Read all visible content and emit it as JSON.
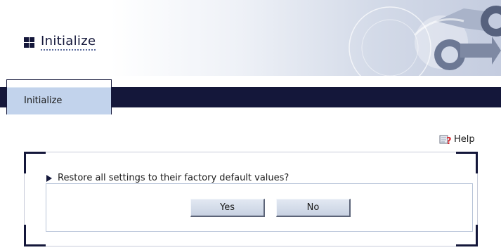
{
  "header": {
    "title": "Initialize"
  },
  "tabs": [
    {
      "label": "Initialize",
      "active": true
    }
  ],
  "help": {
    "label": "Help"
  },
  "dialog": {
    "question": "Restore all settings to their factory default values?",
    "yes_label": "Yes",
    "no_label": "No"
  },
  "colors": {
    "navy": "#14173a",
    "tab_bg": "#c2d3ec",
    "button_bg": "#d6dfec",
    "box_border": "#b7c3d8",
    "help_icon_red": "#d8262c"
  },
  "icons": [
    "grid-icon",
    "help-icon",
    "arrow-bullet-icon"
  ]
}
